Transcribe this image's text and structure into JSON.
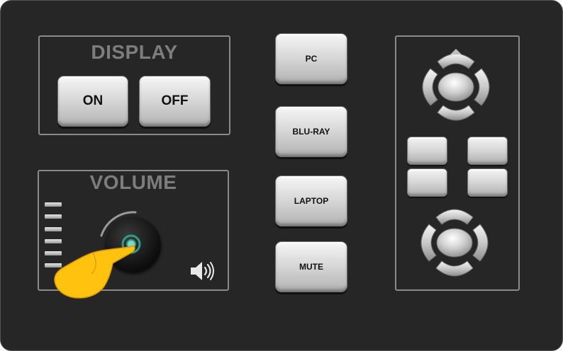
{
  "display": {
    "title": "DISPLAY",
    "on_label": "ON",
    "off_label": "OFF"
  },
  "volume": {
    "title": "VOLUME",
    "level_bars": 6
  },
  "sources": {
    "pc_label": "PC",
    "bluray_label": "BLU-RAY",
    "laptop_label": "LAPTOP",
    "mute_label": "MUTE"
  },
  "icons": {
    "speaker": "speaker-icon",
    "hand": "hand-pointer-icon",
    "dpad": "dpad-arrows-icon"
  },
  "colors": {
    "panel": "#262626",
    "border": "#8a8a8a",
    "title": "#7d7d7d",
    "knob_ring": "#2e9c86",
    "hand": "#ffc20e"
  }
}
